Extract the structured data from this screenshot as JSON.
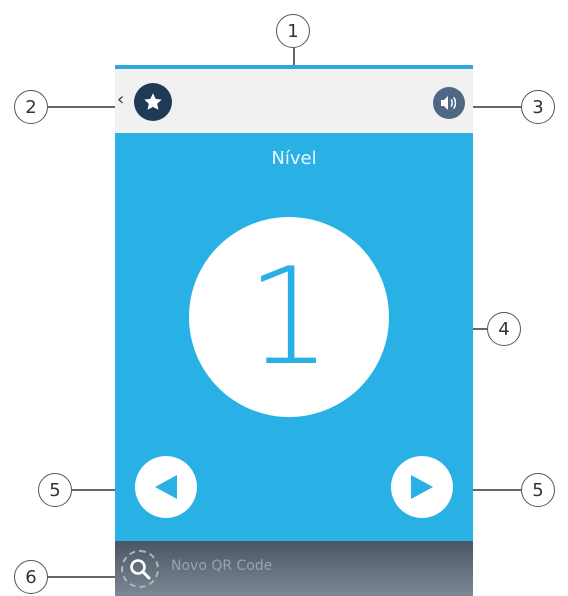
{
  "callouts": [
    "1",
    "2",
    "3",
    "4",
    "5",
    "5",
    "6"
  ],
  "screen": {
    "title": "Nível",
    "level": "1",
    "back_glyph": "‹",
    "bottom_bar": {
      "label": "Novo QR Code"
    }
  },
  "icons": {
    "favorites": "star-icon",
    "sound": "speaker-icon",
    "prev": "triangle-left-icon",
    "next": "triangle-right-icon",
    "qr": "magnifier-icon"
  },
  "colors": {
    "primary": "#29b0e4",
    "top_bar": "#f1f1f1",
    "star_button": "#1f3a57",
    "sound_button": "#4e6785",
    "bottom_bar": "#5f6b78"
  }
}
